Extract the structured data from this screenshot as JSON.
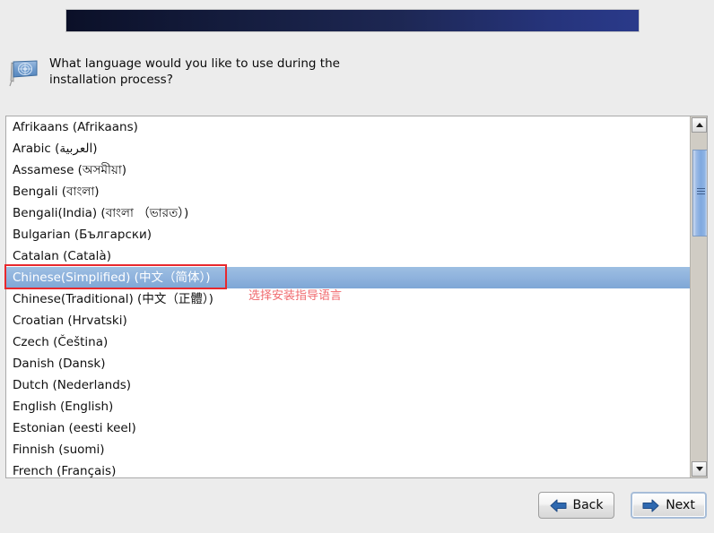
{
  "window": {
    "title": "",
    "background_color": "#ececec"
  },
  "banner": {
    "name": "installer-banner",
    "gradient_start": "#0b1028",
    "gradient_end": "#2a3a8a"
  },
  "prompt": {
    "icon": "flag-icon",
    "text": "What language would you like to use during the\ninstallation process?"
  },
  "language_list": {
    "selected_index": 7,
    "items": [
      "Afrikaans (Afrikaans)",
      "Arabic (العربية)",
      "Assamese (অসমীয়া)",
      "Bengali (বাংলা)",
      "Bengali(India) (বাংলা （ভারত）)",
      "Bulgarian (Български)",
      "Catalan (Català)",
      "Chinese(Simplified) (中文（简体）)",
      "Chinese(Traditional) (中文（正體）)",
      "Croatian (Hrvatski)",
      "Czech (Čeština)",
      "Danish (Dansk)",
      "Dutch (Nederlands)",
      "English (English)",
      "Estonian (eesti keel)",
      "Finnish (suomi)",
      "French (Français)"
    ]
  },
  "scrollbar": {
    "up_arrow": "chevron-up-icon",
    "down_arrow": "chevron-down-icon",
    "thumb_color": "#7fa8df"
  },
  "annotation": {
    "box_color": "#e8282d",
    "text": "选择安装指导语言",
    "text_color": "#f06a6e"
  },
  "buttons": {
    "back_label": "Back",
    "next_label": "Next",
    "arrow_color": "#2f69b0"
  }
}
